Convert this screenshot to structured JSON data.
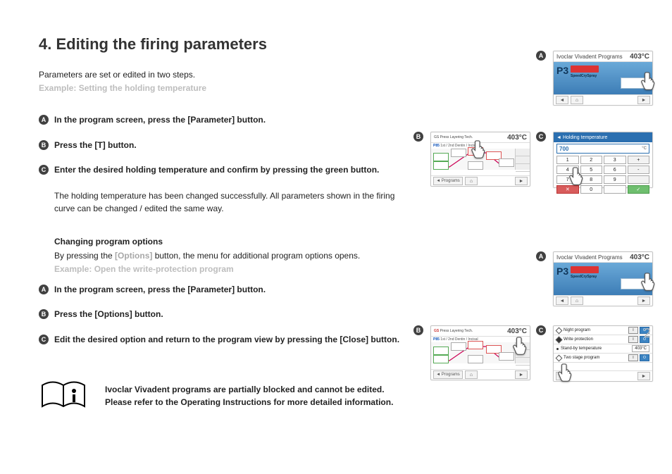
{
  "title": "4. Editing the firing parameters",
  "intro": "Parameters are set or edited in two steps.",
  "example1_label": "Example: Setting the holding temperature",
  "steps1": {
    "a": "In the program screen, press the [Parameter] button.",
    "b": "Press the [T] button.",
    "c": "Enter the desired holding temperature and confirm by pressing the green button."
  },
  "para1": "The holding temperature has been changed successfully. All parameters shown in the firing curve can be changed / edited the same way.",
  "sub_head": "Changing program options",
  "sub_body_pre": "By pressing the ",
  "sub_body_grey": "[Options]",
  "sub_body_post": " button, the menu for additional program options opens.",
  "example2_label": "Example: Open the write-protection program",
  "steps2": {
    "a": "In the program screen, press the [Parameter] button.",
    "b": "Press the [Options] button.",
    "c": "Edit the desired option and return to the program view by pressing the [Close] button."
  },
  "info_line1": "Ivoclar Vivadent programs are partially blocked and cannot be edited.",
  "info_line2": "Please refer to the Operating Instructions for more detailed information.",
  "thumb": {
    "program_name": "Ivoclar Vivadent Programs",
    "temp": "403",
    "temp_unit": "°C",
    "p3": "P3",
    "p3_sub": "SpeedCrySpray",
    "curve_hdr_gs": "GS",
    "curve_hdr_p": "P85",
    "curve_hdr_txt1": "Press Layering Tech.",
    "curve_hdr_txt2": "1st / 2nd Dentin / Incisal",
    "nav_programs": "◄ Programs",
    "kp_title": "Holding temperature",
    "kp_value": "700",
    "kp_unit": "°C",
    "keys": [
      "1",
      "2",
      "3",
      "+",
      "4",
      "5",
      "6",
      "-",
      "7",
      "8",
      "9"
    ],
    "opt_rows": {
      "r1": "Night program",
      "r2": "Write protection",
      "r3": "Stand-by temperature",
      "r3_val": "403°C",
      "r4": "Two stage program"
    },
    "big2": "2"
  }
}
